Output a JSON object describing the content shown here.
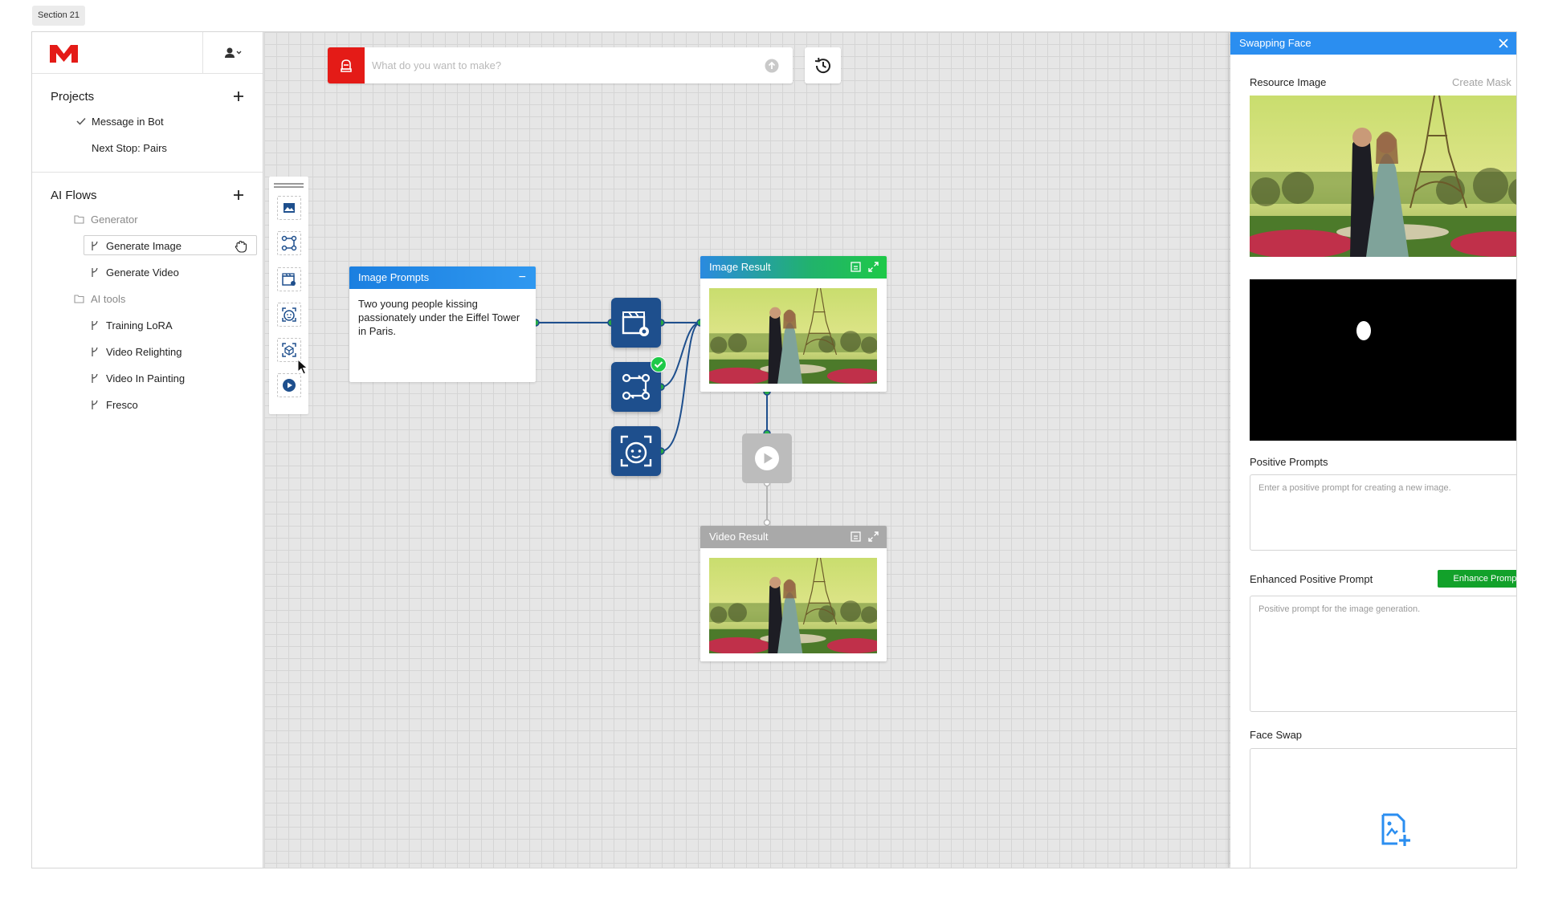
{
  "section_tag": "Section 21",
  "sidebar": {
    "projects_title": "Projects",
    "projects": [
      {
        "label": "Message in Bot",
        "checked": true
      },
      {
        "label": "Next Stop: Pairs",
        "checked": false
      }
    ],
    "flows_title": "AI Flows",
    "folders": [
      {
        "label": "Generator",
        "items": [
          "Generate Image",
          "Generate Video"
        ]
      },
      {
        "label": "AI tools",
        "items": [
          "Training LoRA",
          "Video Relighting",
          "Video In Painting",
          "Fresco"
        ]
      }
    ],
    "selected_item": "Generate Image"
  },
  "prompt_bar": {
    "placeholder": "What do you want to make?"
  },
  "toolbox": {
    "tools": [
      "image-icon",
      "flow-nodes-icon",
      "video-settings-icon",
      "face-icon",
      "cube-scan-icon",
      "play-icon"
    ]
  },
  "nodes": {
    "image_prompts": {
      "title": "Image Prompts",
      "text": "Two young people kissing passionately under the Eiffel Tower in Paris."
    },
    "image_result": {
      "title": "Image Result"
    },
    "video_result": {
      "title": "Video Result"
    }
  },
  "panel": {
    "title": "Swapping Face",
    "resource_label": "Resource Image",
    "create_mask": "Create Mask",
    "positive_label": "Positive Prompts",
    "positive_placeholder": "Enter a positive prompt for creating a new image.",
    "enhanced_label": "Enhanced Positive Prompt",
    "enhance_button": "Enhance Prompt",
    "enhanced_placeholder": "Positive prompt for the image generation.",
    "face_swap_label": "Face Swap"
  },
  "colors": {
    "brand_red": "#e41b17",
    "accent_blue": "#2b8ef0",
    "node_blue": "#1e4f8d",
    "success_green": "#12a12a"
  }
}
